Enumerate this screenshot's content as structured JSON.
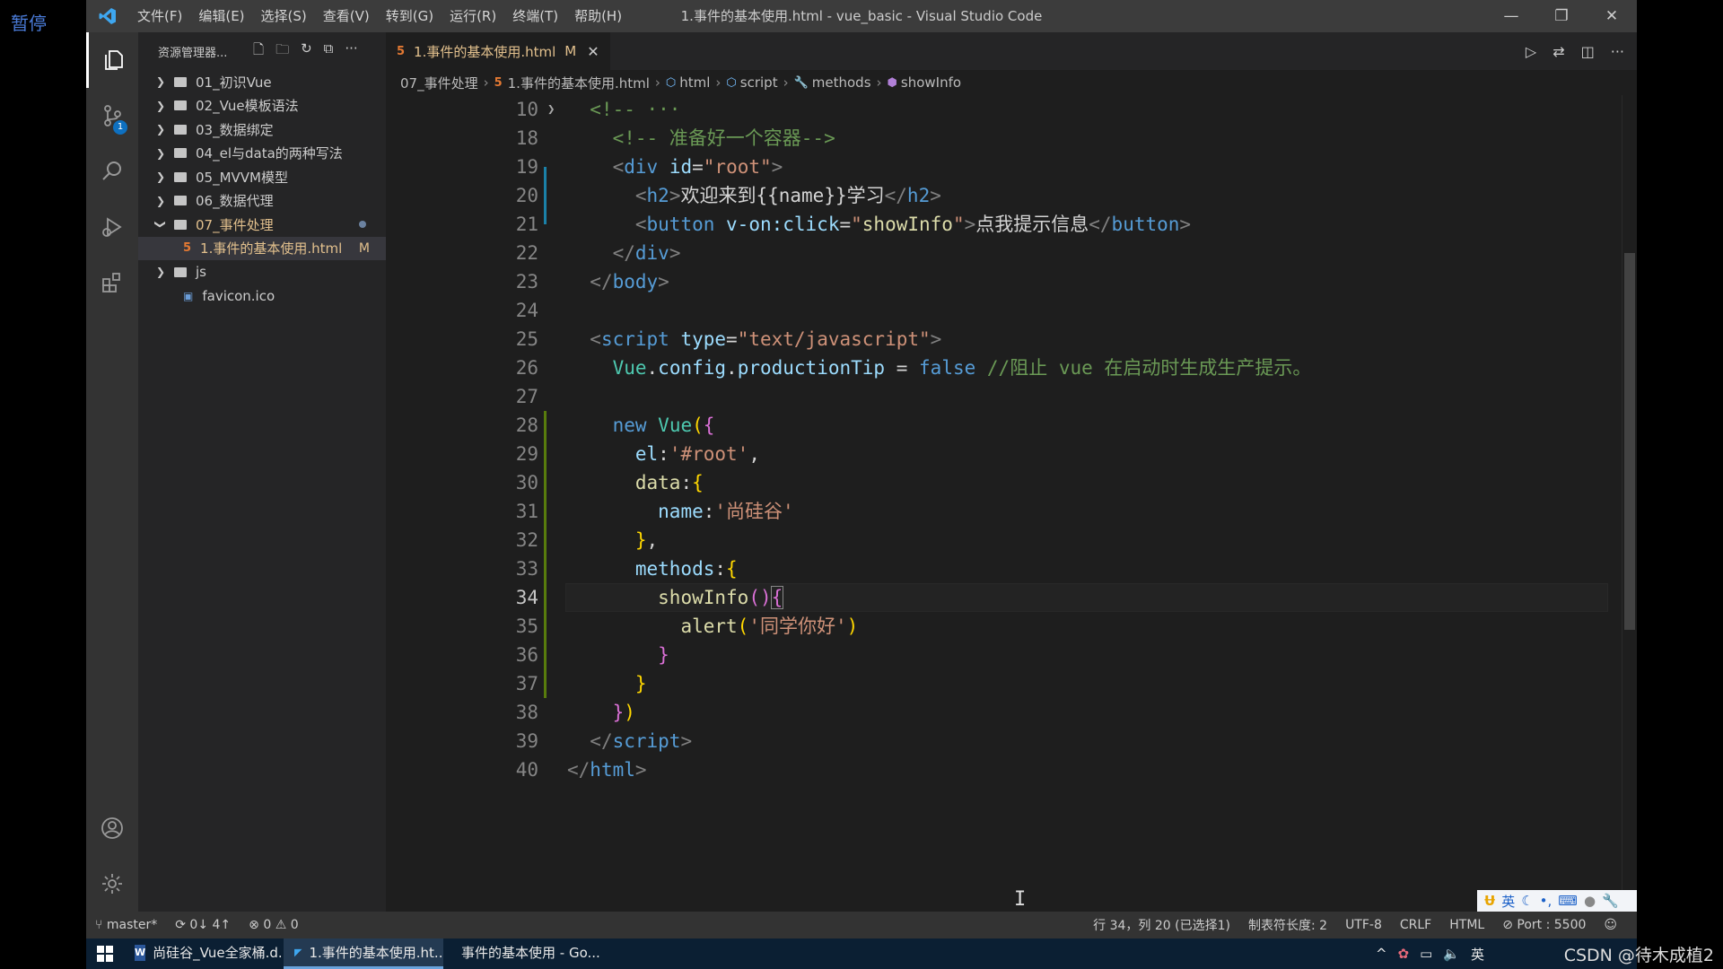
{
  "overlay": {
    "pause_label": "暂停",
    "watermark": "CSDN @待木成植2"
  },
  "titlebar": {
    "menu": [
      "文件(F)",
      "编辑(E)",
      "选择(S)",
      "查看(V)",
      "转到(G)",
      "运行(R)",
      "终端(T)",
      "帮助(H)"
    ],
    "title": "1.事件的基本使用.html - vue_basic - Visual Studio Code",
    "minimize": "—",
    "restore": "❐",
    "close": "✕"
  },
  "activity": {
    "scm_badge": "1"
  },
  "sidebar": {
    "title": "资源管理器...",
    "tree": [
      {
        "label": "01_初识Vue",
        "type": "folder",
        "open": false
      },
      {
        "label": "02_Vue模板语法",
        "type": "folder",
        "open": false
      },
      {
        "label": "03_数据绑定",
        "type": "folder",
        "open": false
      },
      {
        "label": "04_el与data的两种写法",
        "type": "folder",
        "open": false
      },
      {
        "label": "05_MVVM模型",
        "type": "folder",
        "open": false
      },
      {
        "label": "06_数据代理",
        "type": "folder",
        "open": false
      },
      {
        "label": "07_事件处理",
        "type": "folder",
        "open": true
      },
      {
        "label": "1.事件的基本使用.html",
        "type": "html",
        "modified": "M"
      },
      {
        "label": "js",
        "type": "folder",
        "open": false
      },
      {
        "label": "favicon.ico",
        "type": "ico"
      }
    ]
  },
  "editor": {
    "tab": {
      "label": "1.事件的基本使用.html",
      "modified": "M"
    },
    "breadcrumb": [
      "07_事件处理",
      "1.事件的基本使用.html",
      "html",
      "script",
      "methods",
      "showInfo"
    ],
    "current_line": "34",
    "line_numbers": [
      "10",
      "18",
      "19",
      "20",
      "21",
      "22",
      "23",
      "24",
      "25",
      "26",
      "27",
      "28",
      "29",
      "30",
      "31",
      "32",
      "33",
      "34",
      "35",
      "36",
      "37",
      "38",
      "39",
      "40"
    ]
  },
  "statusbar": {
    "branch": "master*",
    "sync": "0↓ 4↑",
    "problems": "0 ⚠ 0",
    "cursor": "行 34，列 20 (已选择1)",
    "tab_size": "制表符长度: 2",
    "encoding": "UTF-8",
    "eol": "CRLF",
    "language": "HTML",
    "port": "Port : 5500"
  },
  "ime": {
    "mode": "英"
  },
  "taskbar": {
    "apps": [
      {
        "label": "尚硅谷_Vue全家桶.d...",
        "icon": "word-icon"
      },
      {
        "label": "1.事件的基本使用.ht...",
        "icon": "vscode-icon",
        "active": true
      },
      {
        "label": "事件的基本使用 - Go...",
        "icon": "chrome-icon"
      }
    ],
    "tray_lang": "英"
  }
}
